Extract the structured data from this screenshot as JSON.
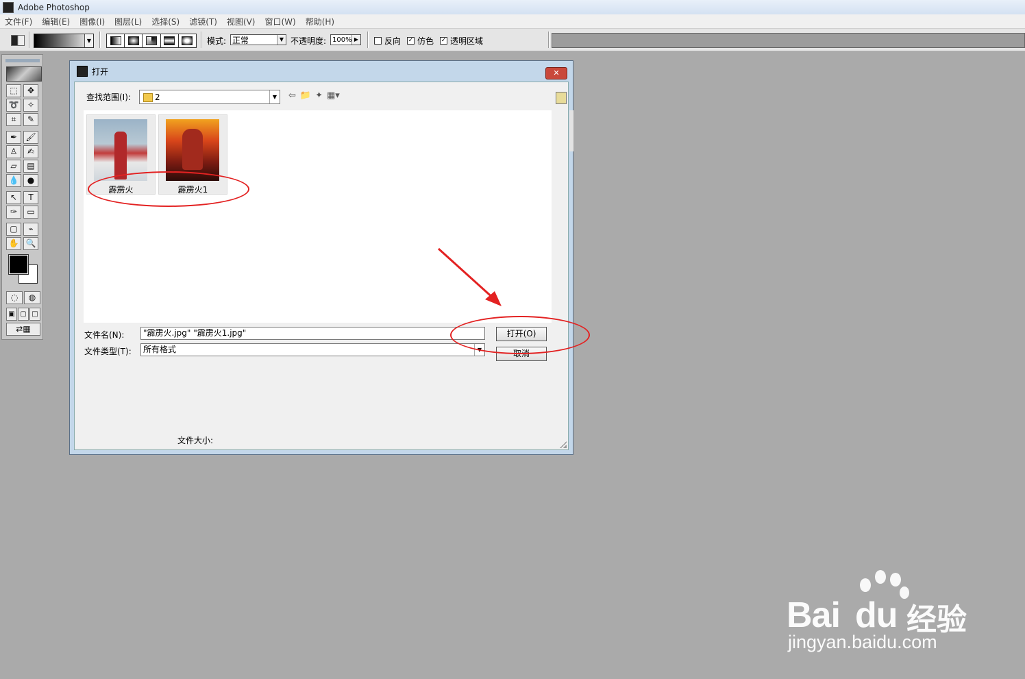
{
  "app": {
    "title": "Adobe Photoshop"
  },
  "menu": [
    "文件(F)",
    "编辑(E)",
    "图像(I)",
    "图层(L)",
    "选择(S)",
    "滤镜(T)",
    "视图(V)",
    "窗口(W)",
    "帮助(H)"
  ],
  "options_bar": {
    "mode_label": "模式:",
    "mode_value": "正常",
    "opacity_label": "不透明度:",
    "opacity_value": "100%",
    "reverse_label": "反向",
    "reverse_checked": false,
    "dither_label": "仿色",
    "dither_checked": true,
    "transparency_label": "透明区域",
    "transparency_checked": true,
    "check_mark": "✓"
  },
  "toolbox": {
    "tools": [
      {
        "name": "marquee-tool",
        "glyph": "⬚"
      },
      {
        "name": "move-tool",
        "glyph": "✥"
      },
      {
        "name": "lasso-tool",
        "glyph": "➰"
      },
      {
        "name": "magic-wand-tool",
        "glyph": "✧"
      },
      {
        "name": "crop-tool",
        "glyph": "⌗"
      },
      {
        "name": "eyedropper-slice-tool",
        "glyph": "✎"
      },
      {
        "name": "airbrush-tool",
        "glyph": "✒"
      },
      {
        "name": "brush-tool",
        "glyph": "🖌"
      },
      {
        "name": "stamp-tool",
        "glyph": "♙"
      },
      {
        "name": "history-brush-tool",
        "glyph": "✍"
      },
      {
        "name": "eraser-tool",
        "glyph": "▱"
      },
      {
        "name": "gradient-tool",
        "glyph": "▤"
      },
      {
        "name": "blur-tool",
        "glyph": "💧"
      },
      {
        "name": "dodge-tool",
        "glyph": "●"
      },
      {
        "name": "path-select-tool",
        "glyph": "↖"
      },
      {
        "name": "type-tool",
        "glyph": "T"
      },
      {
        "name": "pen-tool",
        "glyph": "✑"
      },
      {
        "name": "shape-tool",
        "glyph": "▭"
      },
      {
        "name": "notes-tool",
        "glyph": "▢"
      },
      {
        "name": "eyedropper-tool",
        "glyph": "⌁"
      },
      {
        "name": "hand-tool",
        "glyph": "✋"
      },
      {
        "name": "zoom-tool",
        "glyph": "🔍"
      }
    ]
  },
  "dialog": {
    "title": "打开",
    "close_glyph": "✕",
    "lookin_label": "查找范围(I):",
    "lookin_value": "2",
    "nav_icons": [
      "back-icon",
      "up-folder-icon",
      "new-folder-icon",
      "view-menu-icon"
    ],
    "nav_glyphs": [
      "⇦",
      "📁",
      "✦",
      "▦▾"
    ],
    "files": [
      {
        "name": "霹雳火"
      },
      {
        "name": "霹雳火1"
      }
    ],
    "filename_label": "文件名(N):",
    "filename_value": "\"霹雳火.jpg\" \"霹雳火1.jpg\"",
    "filetype_label": "文件类型(T):",
    "filetype_value": "所有格式",
    "open_button": "打开(O)",
    "cancel_button": "取消",
    "filesize_label": "文件大小:"
  },
  "watermark": {
    "brand": "Bai",
    "brand_du": "du",
    "brand_cn": "经验",
    "url": "jingyan.baidu.com"
  },
  "colors": {
    "annotation": "#e32222",
    "workspace": "#aaaaaa",
    "dialog_frame": "#c3d7ea"
  }
}
